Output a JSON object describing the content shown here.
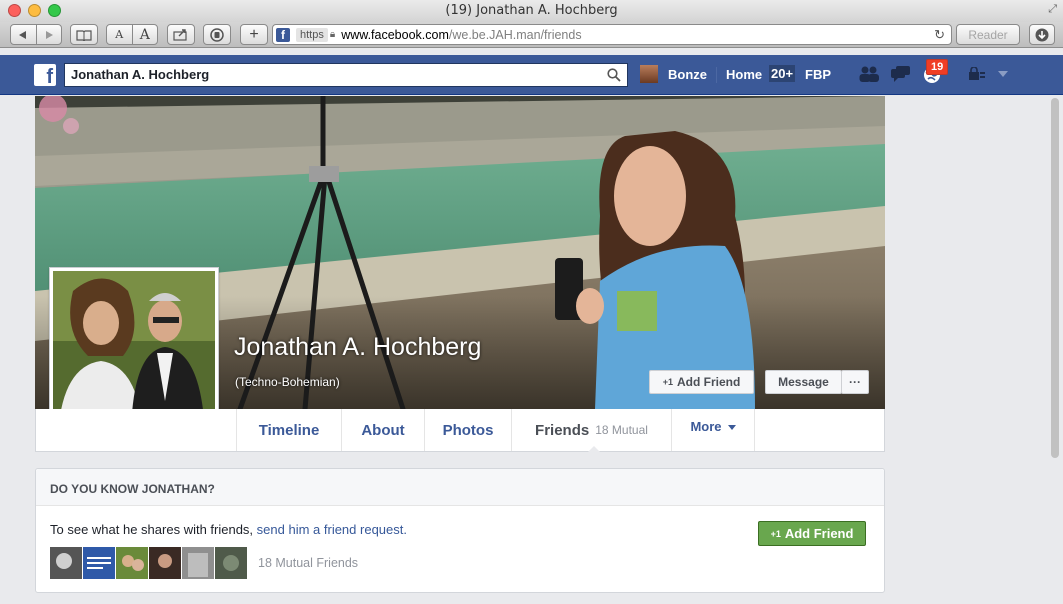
{
  "window": {
    "title": "(19) Jonathan A. Hochberg"
  },
  "browser": {
    "https_label": "https",
    "url_host": "www.facebook.com",
    "url_path": "/we.be.JAH.man/friends",
    "reader_label": "Reader",
    "text_small": "A",
    "text_large": "A",
    "newtab_label": "+"
  },
  "fb": {
    "logo": "f",
    "search_value": "Jonathan A. Hochberg",
    "user_name": "Bonze",
    "home_label": "Home",
    "home_count": "20+",
    "fbp_label": "FBP",
    "notif_count": "19",
    "brand_color": "#3b5998"
  },
  "profile": {
    "name": "Jonathan A. Hochberg",
    "nickname": "(Techno-Bohemian)",
    "add_friend_label": "Add Friend",
    "message_label": "Message",
    "more_label": "···",
    "plus1": "+1"
  },
  "tabs": {
    "timeline": "Timeline",
    "about": "About",
    "photos": "Photos",
    "friends": "Friends",
    "mutual": "18 Mutual",
    "more": "More"
  },
  "know_box": {
    "header": "DO YOU KNOW JONATHAN?",
    "text_prefix": "To see what he shares with friends, ",
    "link": "send him a friend request.",
    "add_friend_label": "Add Friend",
    "mutual_friends": "18 Mutual Friends",
    "add_color": "#69a74e"
  }
}
